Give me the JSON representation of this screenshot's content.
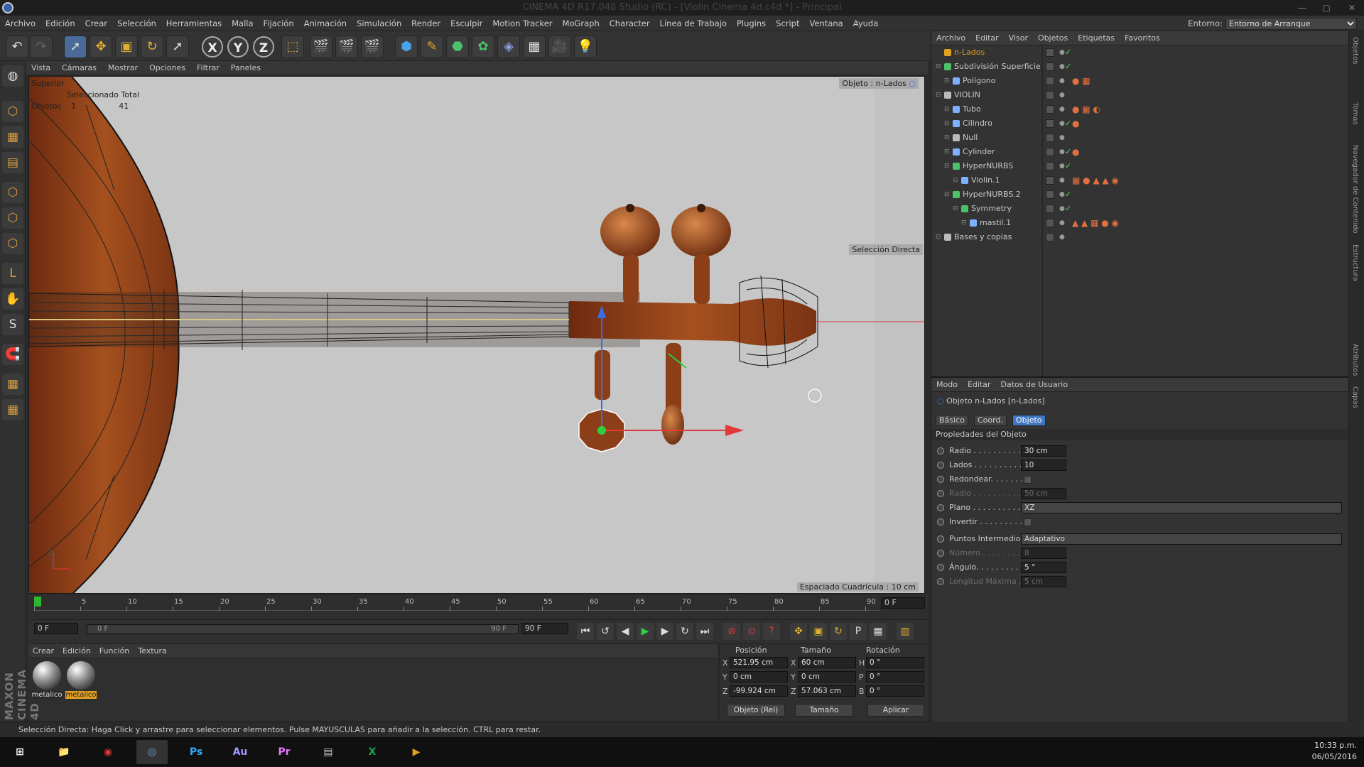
{
  "title": "CINEMA 4D R17.048 Studio (RC) - [Violin Cinema 4d.c4d *] - Principal",
  "menu": [
    "Archivo",
    "Edición",
    "Crear",
    "Selección",
    "Herramientas",
    "Malla",
    "Fijación",
    "Animación",
    "Simulación",
    "Render",
    "Esculpir",
    "Motion Tracker",
    "MoGraph",
    "Character",
    "Línea de Trabajo",
    "Plugins",
    "Script",
    "Ventana",
    "Ayuda"
  ],
  "environment": {
    "label": "Entorno:",
    "value": "Entorno de Arranque"
  },
  "viewport": {
    "menu": [
      "Vista",
      "Cámaras",
      "Mostrar",
      "Opciones",
      "Filtrar",
      "Paneles"
    ],
    "view_name": "Superior",
    "info_header": "Seleccionado Total",
    "info_label": "Objetos",
    "info_selected": "1",
    "info_total": "41",
    "object_hint": "Objeto : n-Lados",
    "mode_hint": "Selección Directa",
    "grid_spacing": "Espaciado Cuadrícula : 10 cm",
    "axis_z": "Z",
    "axis_x": "X"
  },
  "timeline": {
    "ticks": [
      "0",
      "5",
      "10",
      "15",
      "20",
      "25",
      "30",
      "35",
      "40",
      "45",
      "50",
      "55",
      "60",
      "65",
      "70",
      "75",
      "80",
      "85",
      "90"
    ],
    "current_frame": "0 F",
    "start": "0 F",
    "range_start": "0 F",
    "range_end": "90 F",
    "end": "90 F"
  },
  "materials": {
    "menu": [
      "Crear",
      "Edición",
      "Función",
      "Textura"
    ],
    "items": [
      {
        "label": "metalico",
        "selected": false
      },
      {
        "label": "metalico",
        "selected": true
      }
    ]
  },
  "coords": {
    "headers": {
      "pos": "Posición",
      "size": "Tamaño",
      "rot": "Rotación"
    },
    "rows": [
      {
        "axis": "X",
        "pos": "521.95 cm",
        "saxis": "X",
        "size": "60 cm",
        "raxis": "H",
        "rot": "0 °"
      },
      {
        "axis": "Y",
        "pos": "0 cm",
        "saxis": "Y",
        "size": "0 cm",
        "raxis": "P",
        "rot": "0 °"
      },
      {
        "axis": "Z",
        "pos": "-99.924 cm",
        "saxis": "Z",
        "size": "57.063 cm",
        "raxis": "B",
        "rot": "0 °"
      }
    ],
    "mode1": "Objeto (Rel)",
    "mode2": "Tamaño",
    "apply": "Aplicar"
  },
  "statusbar": "Selección Directa: Haga Click y arrastre para seleccionar elementos. Pulse MAYUSCULAS para añadir a la selección. CTRL para restar.",
  "maxon_logo": "MAXON CINEMA 4D",
  "object_manager": {
    "menu": [
      "Archivo",
      "Editar",
      "Visor",
      "Objetos",
      "Etiquetas",
      "Favoritos"
    ],
    "objects": [
      {
        "name": "n-Lados",
        "depth": 0,
        "color": "#e0a020",
        "icon": "polygon-icon",
        "tags": "",
        "active": true
      },
      {
        "name": "Subdivisión Superficie",
        "depth": 0,
        "color": "#4cc16a",
        "icon": "subdivision-icon",
        "tags": ""
      },
      {
        "name": "Polígono",
        "depth": 1,
        "color": "#7fb0ff",
        "icon": "polygon-icon",
        "tags": "● ▦"
      },
      {
        "name": "VIOLIN",
        "depth": 0,
        "color": "#bbb",
        "icon": "null-icon",
        "tags": ""
      },
      {
        "name": "Tubo",
        "depth": 1,
        "color": "#7fb0ff",
        "icon": "tube-icon",
        "tags": "● ▦ ◐"
      },
      {
        "name": "Cilindro",
        "depth": 1,
        "color": "#7fb0ff",
        "icon": "cylinder-icon",
        "tags": "●"
      },
      {
        "name": "Null",
        "depth": 1,
        "color": "#bbb",
        "icon": "null-icon",
        "tags": ""
      },
      {
        "name": "Cylinder",
        "depth": 1,
        "color": "#7fb0ff",
        "icon": "cylinder-icon",
        "tags": "●"
      },
      {
        "name": "HyperNURBS",
        "depth": 1,
        "color": "#4cc16a",
        "icon": "hypernurbs-icon",
        "tags": ""
      },
      {
        "name": "Violin.1",
        "depth": 2,
        "color": "#7fb0ff",
        "icon": "polygon-icon",
        "tags": "▦ ● ▲ ▲ ◉"
      },
      {
        "name": "HyperNURBS.2",
        "depth": 1,
        "color": "#4cc16a",
        "icon": "hypernurbs-icon",
        "tags": ""
      },
      {
        "name": "Symmetry",
        "depth": 2,
        "color": "#4cc16a",
        "icon": "symmetry-icon",
        "tags": ""
      },
      {
        "name": "mastil.1",
        "depth": 3,
        "color": "#7fb0ff",
        "icon": "polygon-icon",
        "tags": "▲ ▲ ▦ ● ◉"
      },
      {
        "name": "Bases y copias",
        "depth": 0,
        "color": "#bbb",
        "icon": "null-icon",
        "tags": ""
      }
    ]
  },
  "attributes": {
    "menu": [
      "Modo",
      "Editar",
      "Datos de Usuario"
    ],
    "object_title": "Objeto n-Lados [n-Lados]",
    "tabs": [
      {
        "label": "Básico",
        "active": false
      },
      {
        "label": "Coord.",
        "active": false
      },
      {
        "label": "Objeto",
        "active": true
      }
    ],
    "section": "Propiedades del Objeto",
    "rows": [
      {
        "label": "Radio . . . . . . . . . . . .",
        "value": "30 cm",
        "disabled": false,
        "type": "num"
      },
      {
        "label": "Lados . . . . . . . . . . . .",
        "value": "10",
        "disabled": false,
        "type": "num"
      },
      {
        "label": "Redondear. . . . . . . .",
        "value": "",
        "disabled": false,
        "type": "check"
      },
      {
        "label": "Radio . . . . . . . . . . . .",
        "value": "50 cm",
        "disabled": true,
        "type": "num"
      },
      {
        "label": "Plano . . . . . . . . . . . .",
        "value": "XZ",
        "disabled": false,
        "type": "select"
      },
      {
        "label": "Invertir . . . . . . . . . .",
        "value": "",
        "disabled": false,
        "type": "check"
      },
      {
        "label": "Puntos Intermedios",
        "value": "Adaptativo",
        "disabled": false,
        "type": "select"
      },
      {
        "label": "Número . . . . . . . . . .",
        "value": "8",
        "disabled": true,
        "type": "num"
      },
      {
        "label": "Ángulo. . . . . . . . . . .",
        "value": "5 °",
        "disabled": false,
        "type": "num"
      },
      {
        "label": "Longitud Máxima . .",
        "value": "5 cm",
        "disabled": true,
        "type": "num"
      }
    ]
  },
  "right_tabs": [
    "Objetos",
    "Tomas",
    "Navegador de Contenido",
    "Estructura",
    "Atributos",
    "Capas"
  ],
  "taskbar": {
    "apps": [
      {
        "label": "⊞",
        "name": "start-button"
      },
      {
        "label": "📁",
        "name": "explorer-button"
      },
      {
        "label": "◉",
        "name": "chrome-button"
      },
      {
        "label": "◎",
        "name": "cinema4d-button"
      },
      {
        "label": "Ps",
        "name": "photoshop-button"
      },
      {
        "label": "Au",
        "name": "audition-button"
      },
      {
        "label": "Pr",
        "name": "premiere-button"
      },
      {
        "label": "▤",
        "name": "calculator-button"
      },
      {
        "label": "X",
        "name": "excel-button"
      },
      {
        "label": "▶",
        "name": "media-button"
      }
    ],
    "time": "10:33 p.m.",
    "date": "06/05/2016"
  },
  "colors": {
    "accent": "#3f78c2",
    "selected": "#e0a020",
    "active_green": "#2fb82f"
  }
}
